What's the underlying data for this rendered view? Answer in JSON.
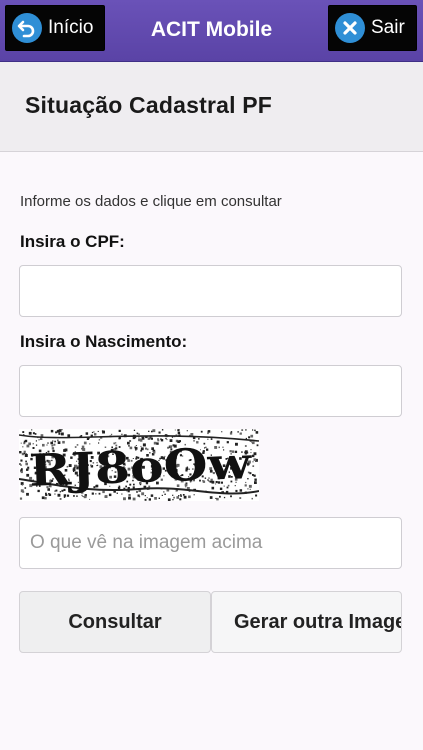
{
  "topbar": {
    "title": "ACIT Mobile",
    "left_button": {
      "label": "Início",
      "icon": "back-arrow-icon"
    },
    "right_button": {
      "label": "Sair",
      "icon": "close-icon"
    }
  },
  "header": {
    "title": "Situação Cadastral PF"
  },
  "form": {
    "instruction": "Informe os dados e clique em consultar",
    "cpf_label": "Insira o CPF:",
    "cpf_value": "",
    "birth_label": "Insira o Nascimento:",
    "birth_value": "",
    "captcha_text": "RJ8oOw",
    "captcha_placeholder": "O que vê na imagem acima",
    "captcha_value": ""
  },
  "actions": {
    "consult_label": "Consultar",
    "regenerate_label": "Gerar outra Imagem"
  },
  "colors": {
    "topbar": "#5a43a6",
    "icon_blue": "#2f8fd6",
    "button_black": "#050505",
    "header_band": "#efedf0"
  }
}
